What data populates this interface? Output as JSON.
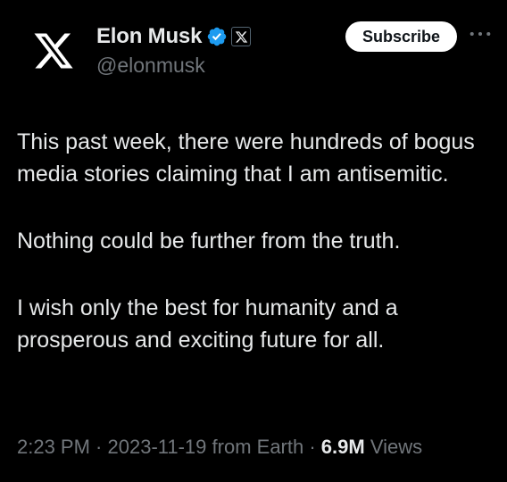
{
  "author": {
    "display_name": "Elon Musk",
    "handle": "@elonmusk",
    "avatar_icon": "x-logo-icon",
    "verified_badge_icon": "verified-badge-icon",
    "affiliate_badge_icon": "x-affiliate-icon",
    "verified_color": "#1d9bf0"
  },
  "actions": {
    "subscribe_label": "Subscribe",
    "more_icon": "more-dots-icon"
  },
  "tweet": {
    "paragraphs": [
      "This past week, there were hundreds of bogus media stories claiming that I am antisemitic.",
      "Nothing could be further from the truth.",
      "I wish only the best for humanity and a prosperous and exciting future for all."
    ]
  },
  "meta": {
    "time": "2:23 PM",
    "separator": " · ",
    "date": "2023-11-19",
    "source": "from Earth",
    "views_count": "6.9M",
    "views_label": "Views"
  },
  "colors": {
    "background": "#000000",
    "text": "#e7e9ea",
    "secondary": "#71767b",
    "button_bg": "#ffffff"
  }
}
